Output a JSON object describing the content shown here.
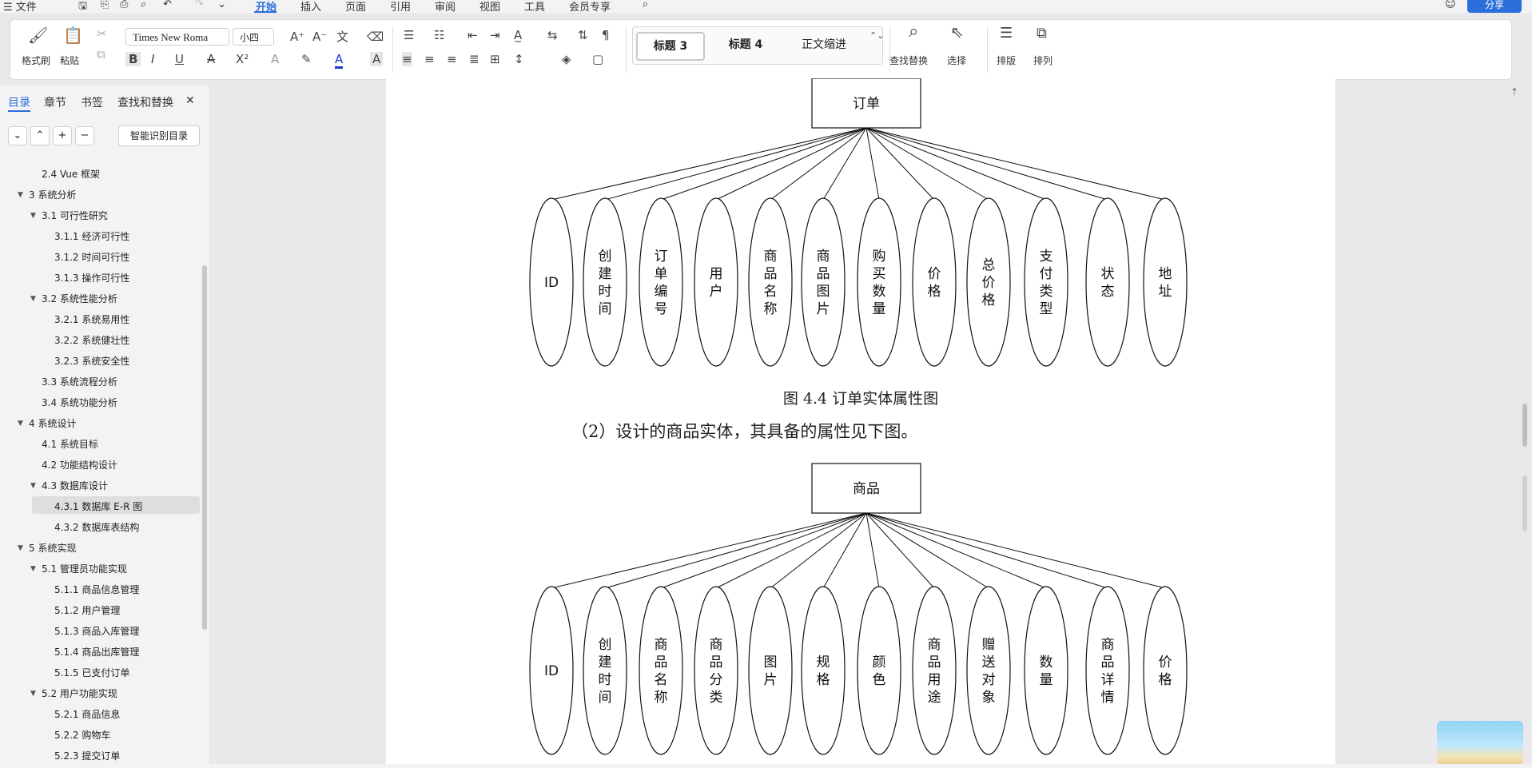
{
  "menubar": {
    "file": "☰ 文件",
    "tabs": [
      "开始",
      "插入",
      "页面",
      "引用",
      "审阅",
      "视图",
      "工具",
      "会员专享"
    ],
    "share": "分享"
  },
  "ribbon": {
    "format_painter": "格式刷",
    "paste": "粘贴",
    "font_name": "Times New Roma",
    "font_size": "小四",
    "styles": [
      "标题 3",
      "标题 4",
      "正文缩进"
    ],
    "find_replace": "查找替换",
    "select": "选择",
    "layout": "排版",
    "arrange": "排列"
  },
  "nav": {
    "tabs": [
      "目录",
      "章节",
      "书签",
      "查找和替换"
    ],
    "smart_toc": "智能识别目录",
    "toc": [
      {
        "label": "2.4 Vue 框架",
        "level": 2
      },
      {
        "label": "3  系统分析",
        "level": 1
      },
      {
        "label": "3.1 可行性研究",
        "level": 2
      },
      {
        "label": "3.1.1 经济可行性",
        "level": 3
      },
      {
        "label": "3.1.2 时间可行性",
        "level": 3
      },
      {
        "label": "3.1.3 操作可行性",
        "level": 3
      },
      {
        "label": "3.2 系统性能分析",
        "level": 2
      },
      {
        "label": "3.2.1 系统易用性",
        "level": 3
      },
      {
        "label": "3.2.2 系统健壮性",
        "level": 3
      },
      {
        "label": "3.2.3 系统安全性",
        "level": 3
      },
      {
        "label": "3.3  系统流程分析",
        "level": 2
      },
      {
        "label": "3.4 系统功能分析",
        "level": 2
      },
      {
        "label": "4  系统设计",
        "level": 1
      },
      {
        "label": "4.1 系统目标",
        "level": 2
      },
      {
        "label": "4.2 功能结构设计",
        "level": 2
      },
      {
        "label": "4.3 数据库设计",
        "level": 2
      },
      {
        "label": "4.3.1  数据库 E-R 图",
        "level": 3
      },
      {
        "label": "4.3.2  数据库表结构",
        "level": 3
      },
      {
        "label": "5  系统实现",
        "level": 1
      },
      {
        "label": "5.1  管理员功能实现",
        "level": 2
      },
      {
        "label": "5.1.1  商品信息管理",
        "level": 3
      },
      {
        "label": "5.1.2  用户管理",
        "level": 3
      },
      {
        "label": "5.1.3  商品入库管理",
        "level": 3
      },
      {
        "label": "5.1.4  商品出库管理",
        "level": 3
      },
      {
        "label": "5.1.5  已支付订单",
        "level": 3
      },
      {
        "label": "5.2  用户功能实现",
        "level": 2
      },
      {
        "label": "5.2.1  商品信息",
        "level": 3
      },
      {
        "label": "5.2.2  购物车",
        "level": 3
      },
      {
        "label": "5.2.3  提交订单",
        "level": 3
      }
    ]
  },
  "document": {
    "diagram1": {
      "entity": "订单",
      "attributes": [
        "ID",
        "创建时间",
        "订单编号",
        "用户",
        "商品名称",
        "商品图片",
        "购买数量",
        "价格",
        "总价格",
        "支付类型",
        "状态",
        "地址"
      ]
    },
    "caption1": "图 4.4  订单实体属性图",
    "paragraph": "（2）设计的商品实体，其具备的属性见下图。",
    "diagram2": {
      "entity": "商品",
      "attributes": [
        "ID",
        "创建时间",
        "商品名称",
        "商品分类",
        "图片",
        "规格",
        "颜色",
        "商品用途",
        "赠送对象",
        "数量",
        "商品详情",
        "价格"
      ]
    }
  }
}
